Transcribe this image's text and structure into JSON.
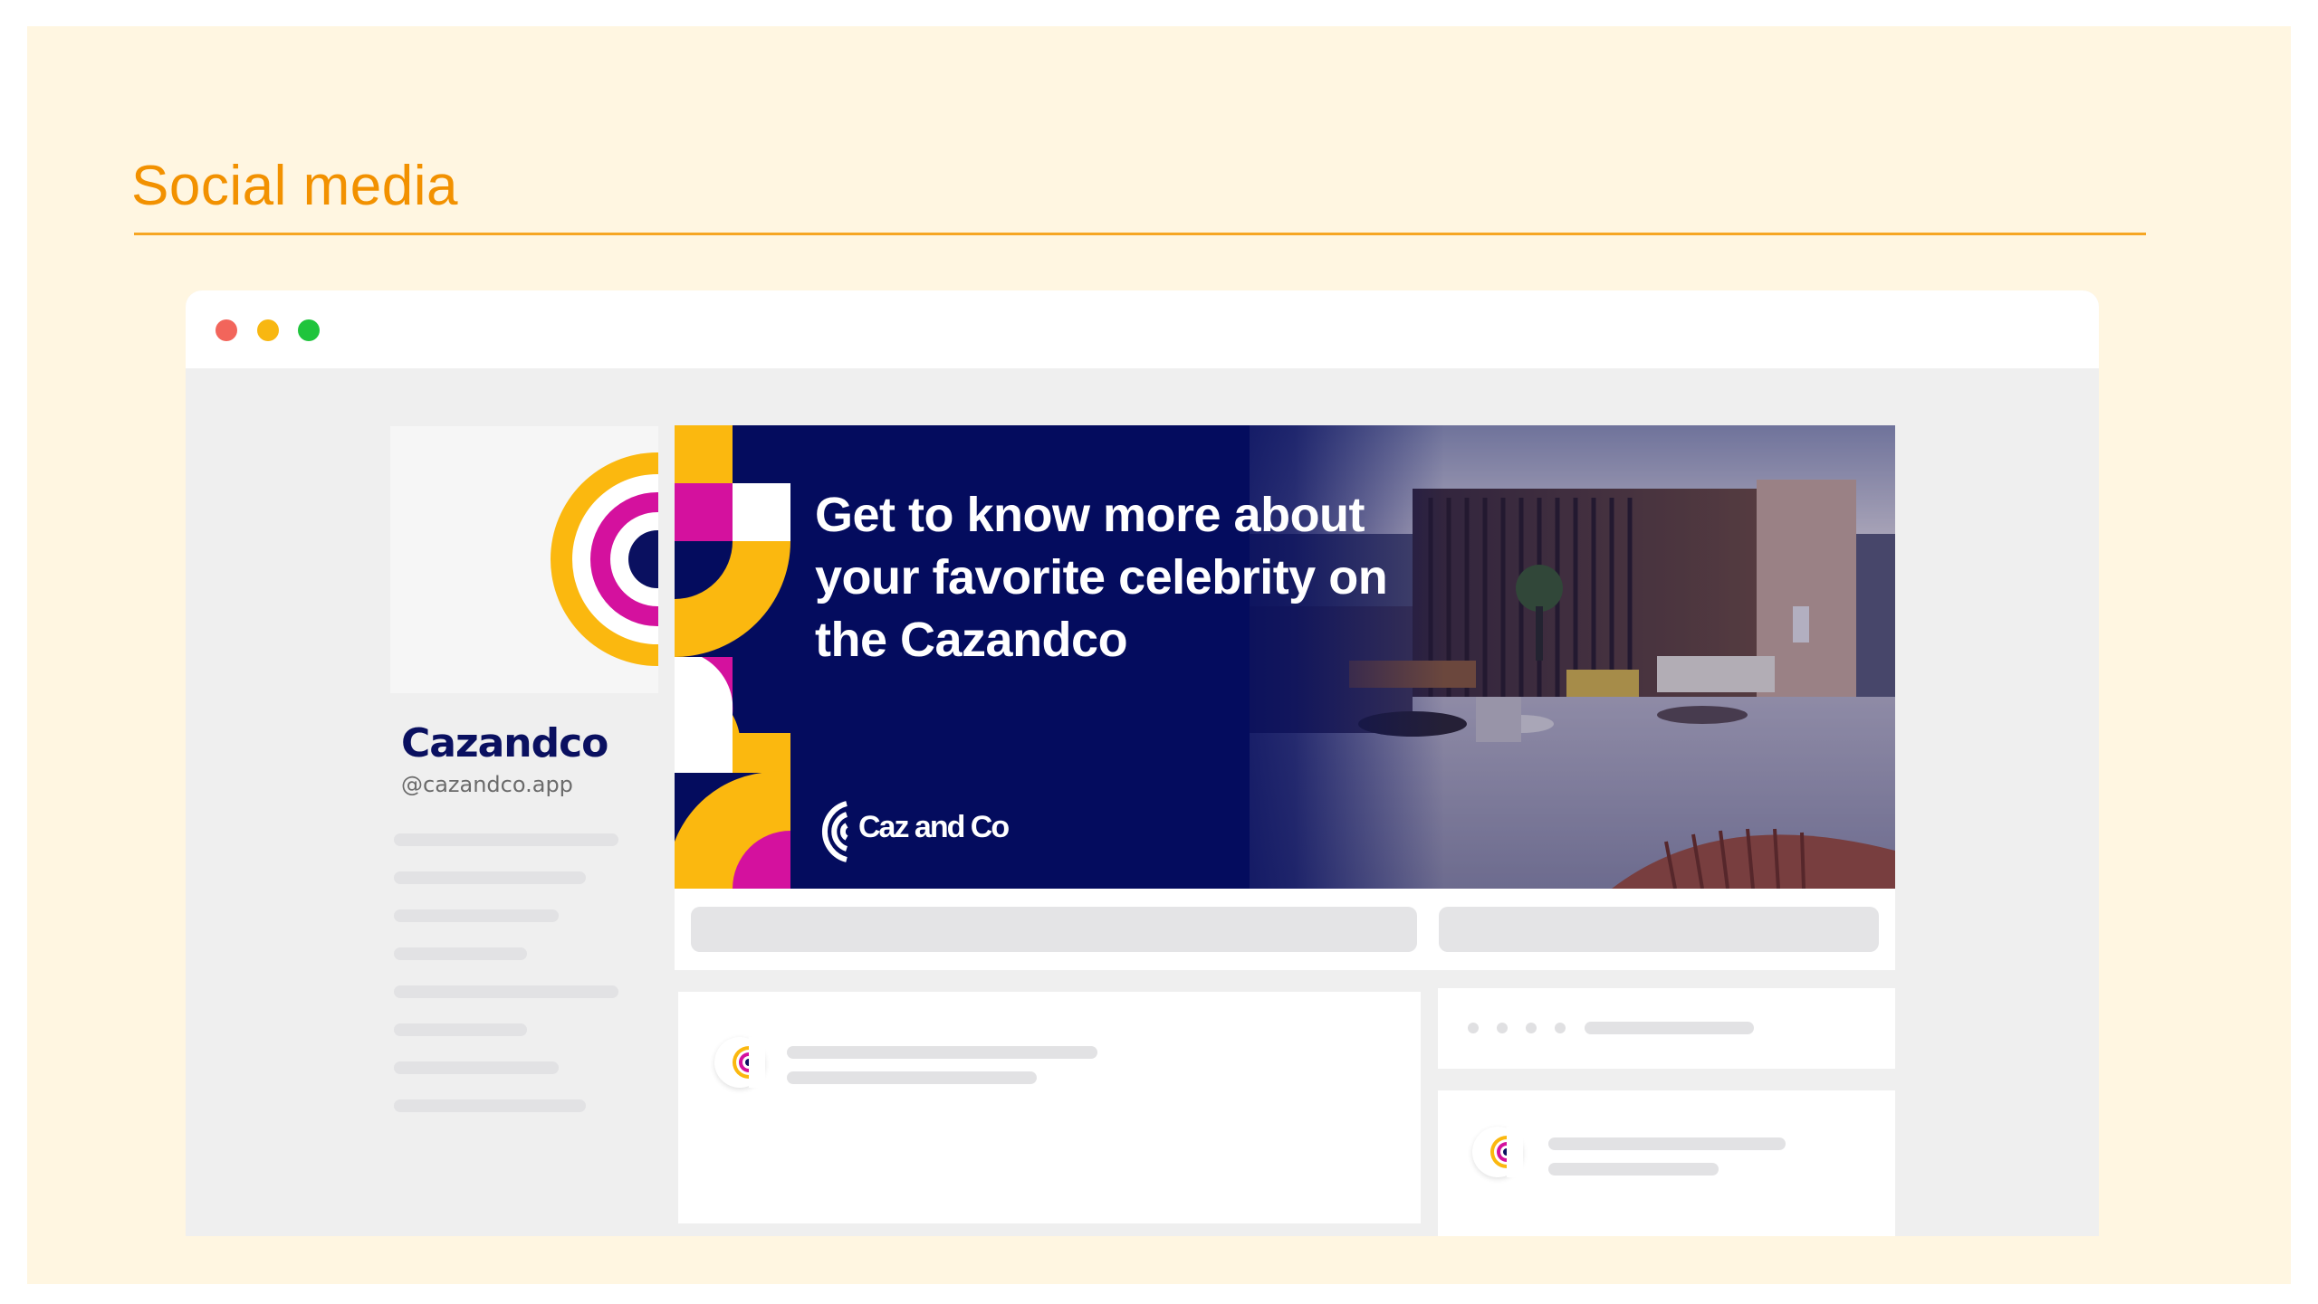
{
  "section": {
    "title": "Social media"
  },
  "window": {
    "controls": [
      "close",
      "minimize",
      "maximize"
    ]
  },
  "profile": {
    "name": "Cazandco",
    "handle": "@cazandco.app"
  },
  "cover": {
    "headline": "Get to know more about your favorite celebrity on the Cazandco",
    "brand_text": "Caz and Co"
  },
  "colors": {
    "accent": "#f29100",
    "navy": "#040c5e",
    "yellow": "#fbb80f",
    "magenta": "#d4119e",
    "panel_bg": "#fff6e1"
  },
  "icons": {
    "brand_logo": "cazandco-logo-icon",
    "avatar": "cazandco-avatar-icon"
  }
}
